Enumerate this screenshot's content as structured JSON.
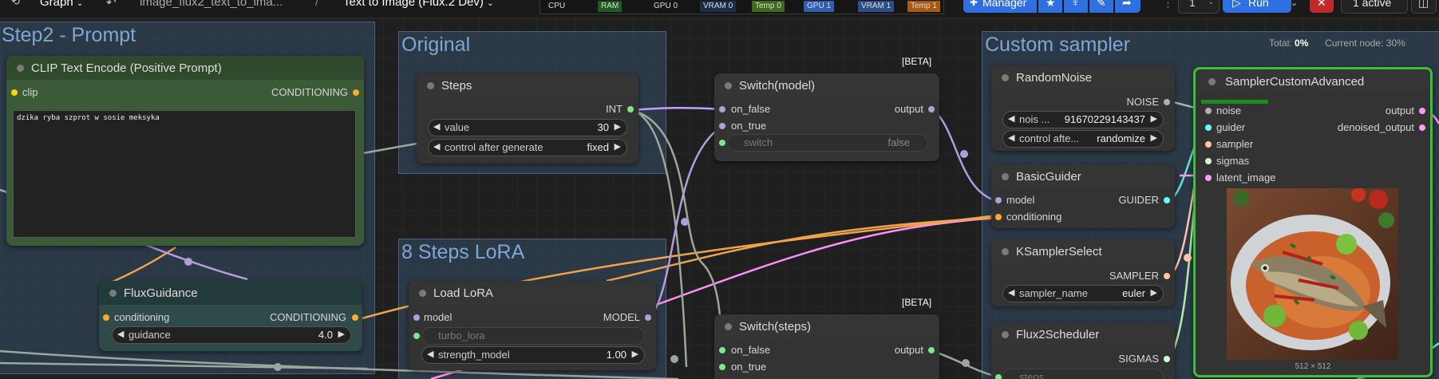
{
  "topbar": {
    "graph_tab": "Graph",
    "workflow_file": "image_flux2_text_to_ima...",
    "breadcrumb_separator": "/",
    "workflow_title": "Text to Image (Flux.2 Dev)",
    "monitors": [
      "CPU",
      "RAM",
      "GPU 0",
      "VRAM 0",
      "Temp 0",
      "GPU 1",
      "VRAM 1",
      "Temp 1"
    ],
    "manager_label": "Manager",
    "queue_count": "1",
    "run_label": "Run",
    "active_label": "1 active"
  },
  "groups": {
    "prompt": "Step2 - Prompt",
    "original": "Original",
    "lora": "8 Steps LoRA",
    "sampler": "Custom sampler"
  },
  "progress": {
    "total_label": "Total:",
    "total_value": "0%",
    "current_label": "Current node:",
    "current_value": "30%"
  },
  "nodes": {
    "clip_text_encode": {
      "title": "CLIP Text Encode (Positive Prompt)",
      "input_clip": "clip",
      "output": "CONDITIONING",
      "prompt_text": "dzika ryba szprot w sosie meksyka"
    },
    "flux_guidance": {
      "title": "FluxGuidance",
      "input": "conditioning",
      "output": "CONDITIONING",
      "guidance_label": "guidance",
      "guidance_value": "4.0"
    },
    "steps": {
      "title": "Steps",
      "output": "INT",
      "value_label": "value",
      "value": "30",
      "control_label": "control after generate",
      "control_value": "fixed"
    },
    "load_lora": {
      "title": "Load LoRA",
      "input_model": "model",
      "output": "MODEL",
      "lora_name": "turbo_lora",
      "strength_label": "strength_model",
      "strength_value": "1.00"
    },
    "switch_model": {
      "badge": "[BETA]",
      "title": "Switch(model)",
      "in_false": "on_false",
      "in_true": "on_true",
      "output": "output",
      "switch_label": "switch",
      "switch_value": "false"
    },
    "switch_steps": {
      "badge": "[BETA]",
      "title": "Switch(steps)",
      "in_false": "on_false",
      "in_true": "on_true",
      "output": "output"
    },
    "random_noise": {
      "title": "RandomNoise",
      "output": "NOISE",
      "seed_label": "nois ...",
      "seed_value": "91670229143437",
      "control_label": "control afte...",
      "control_value": "randomize"
    },
    "basic_guider": {
      "title": "BasicGuider",
      "in_model": "model",
      "in_conditioning": "conditioning",
      "output": "GUIDER"
    },
    "ksampler_select": {
      "title": "KSamplerSelect",
      "output": "SAMPLER",
      "sampler_label": "sampler_name",
      "sampler_value": "euler"
    },
    "flux2_scheduler": {
      "title": "Flux2Scheduler",
      "output": "SIGMAS",
      "steps_label": "steps"
    },
    "sampler_custom": {
      "title": "SamplerCustomAdvanced",
      "in_noise": "noise",
      "in_guider": "guider",
      "in_sampler": "sampler",
      "in_sigmas": "sigmas",
      "in_latent": "latent_image",
      "out_output": "output",
      "out_denoised": "denoised_output",
      "preview_size": "512 × 512",
      "progress_fraction": 0.3
    }
  },
  "colors": {
    "conditioning": "#ffa931",
    "model": "#b39ddb",
    "int": "#7ee787",
    "clip": "#ffd500",
    "latent": "#ff9cf9",
    "noise": "#b0b0b0",
    "guider": "#66ffff",
    "sampler": "#ffc3a8",
    "sigmas": "#cdffcd",
    "active_node": "#39c236",
    "run_button": "#2f6fe0",
    "manager_button": "#2f6fe0",
    "stop_button": "#c22a2a"
  }
}
